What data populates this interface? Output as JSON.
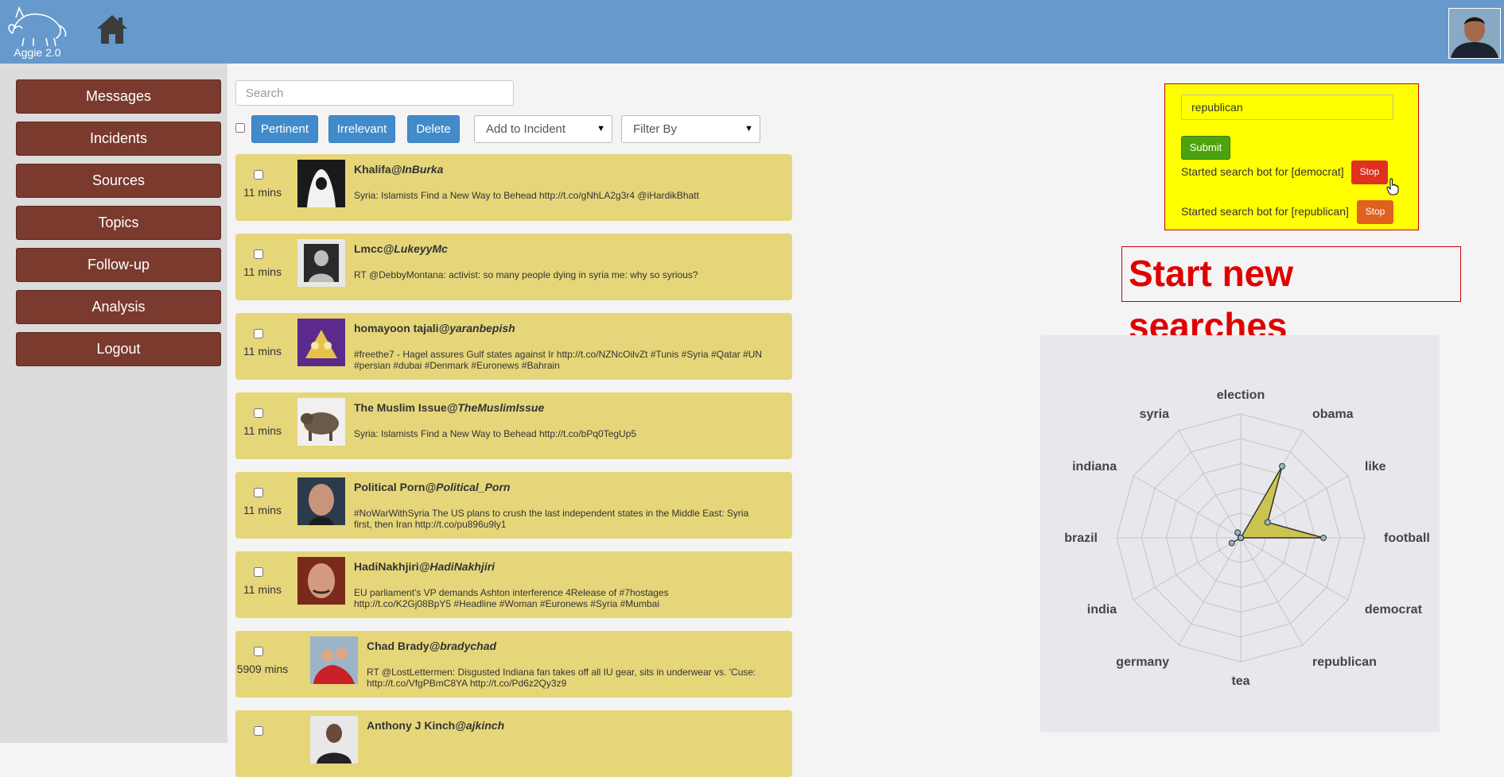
{
  "header": {
    "logo_text": "Aggie 2.0",
    "home_icon": "home-icon",
    "avatar_icon": "user-avatar"
  },
  "sidebar": {
    "items": [
      {
        "label": "Messages"
      },
      {
        "label": "Incidents"
      },
      {
        "label": "Sources"
      },
      {
        "label": "Topics"
      },
      {
        "label": "Follow-up"
      },
      {
        "label": "Analysis"
      },
      {
        "label": "Logout"
      }
    ]
  },
  "toolbar": {
    "search_placeholder": "Search",
    "pertinent_label": "Pertinent",
    "irrelevant_label": "Irrelevant",
    "delete_label": "Delete",
    "add_to_incident_label": "Add to Incident",
    "filter_by_label": "Filter By"
  },
  "messages": [
    {
      "time": "11 mins",
      "author": "Khalifa",
      "handle": "@InBurka",
      "text": "Syria: Islamists Find a New Way to Behead http://t.co/gNhLA2g3r4 @iHardikBhatt"
    },
    {
      "time": "11 mins",
      "author": "Lmcc",
      "handle": "@LukeyyMc",
      "text": "RT @DebbyMontana: activist: so many people dying in syria me: why so syrious?"
    },
    {
      "time": "11 mins",
      "author": "homayoon tajali",
      "handle": "@yaranbepish",
      "text": "#freethe7 - Hagel assures Gulf states against Ir http://t.co/NZNcOilvZt #Tunis #Syria #Qatar #UN #persian #dubai #Denmark #Euronews #Bahrain"
    },
    {
      "time": "11 mins",
      "author": "The Muslim Issue",
      "handle": "@TheMuslimIssue",
      "text": "Syria: Islamists Find a New Way to Behead http://t.co/bPq0TegUp5"
    },
    {
      "time": "11 mins",
      "author": "Political Porn",
      "handle": "@Political_Porn",
      "text": "#NoWarWithSyria The US plans to crush the last independent states in the Middle East: Syria first, then Iran http://t.co/pu896u9ly1"
    },
    {
      "time": "11 mins",
      "author": "HadiNakhjiri",
      "handle": "@HadiNakhjiri",
      "text": "EU parliament's VP demands Ashton interference 4Release of #7hostages http://t.co/K2Gj08BpY5 #Headline #Woman #Euronews #Syria #Mumbai"
    },
    {
      "time": "5909 mins",
      "author": "Chad Brady",
      "handle": "@bradychad",
      "text": "RT @LostLettermen: Disgusted Indiana fan takes off all IU gear, sits in underwear vs. 'Cuse: http://t.co/VfgPBmC8YA http://t.co/Pd6z2Qy3z9"
    },
    {
      "time": "",
      "author": "Anthony J Kinch",
      "handle": "@ajkinch",
      "text": ""
    }
  ],
  "search_bot": {
    "input_value": "republican",
    "submit_label": "Submit",
    "lines": [
      {
        "text": "Started search bot for [democrat]",
        "stop_label": "Stop",
        "stop_color": "#e0301e"
      },
      {
        "text": "Started search bot for [republican]",
        "stop_label": "Stop",
        "stop_color": "#e0601e"
      }
    ]
  },
  "annotation": "Start new searches",
  "chart_data": {
    "type": "radar",
    "categories": [
      "election",
      "obama",
      "like",
      "football",
      "democrat",
      "republican",
      "tea",
      "germany",
      "india",
      "brazil",
      "indiana",
      "syria"
    ],
    "values": [
      0,
      4,
      1.5,
      4,
      0,
      0,
      0,
      0,
      0.5,
      0,
      0,
      0.3
    ],
    "max": 6,
    "rings": 5,
    "fill_color": "#c8c040",
    "grid": true
  }
}
